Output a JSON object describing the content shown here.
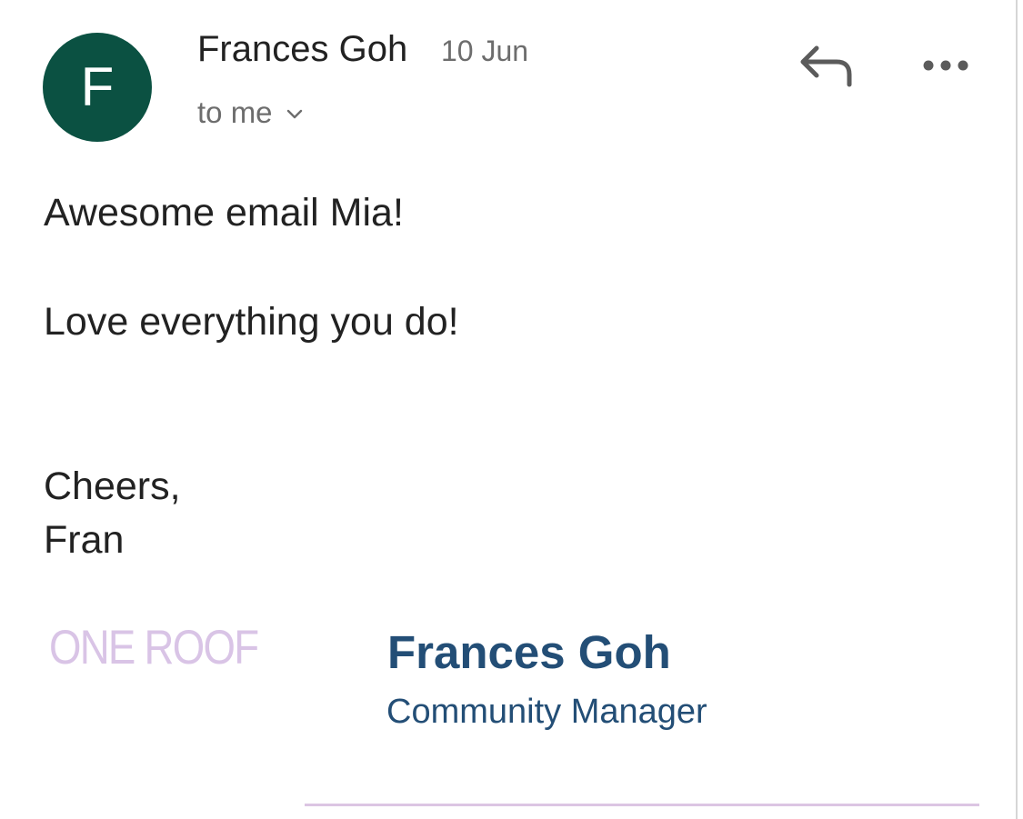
{
  "header": {
    "avatar_initial": "F",
    "avatar_color": "#0b5142",
    "sender_name": "Frances Goh",
    "date": "10 Jun",
    "recipient": "to me",
    "recipient_chevron_icon": "chevron-down-icon",
    "reply_icon": "reply-arrow-icon",
    "more_icon": "more-horizontal-icon"
  },
  "body": {
    "lines": [
      "Awesome email Mia!",
      "Love everything you do!",
      "Cheers,",
      "Fran"
    ]
  },
  "signature": {
    "logo_text": "ONE ROOF",
    "logo_color": "#d9c4e6",
    "name": "Frances Goh",
    "title": "Community Manager",
    "accent_color": "#234e76",
    "divider_color": "#dcc5e3"
  }
}
